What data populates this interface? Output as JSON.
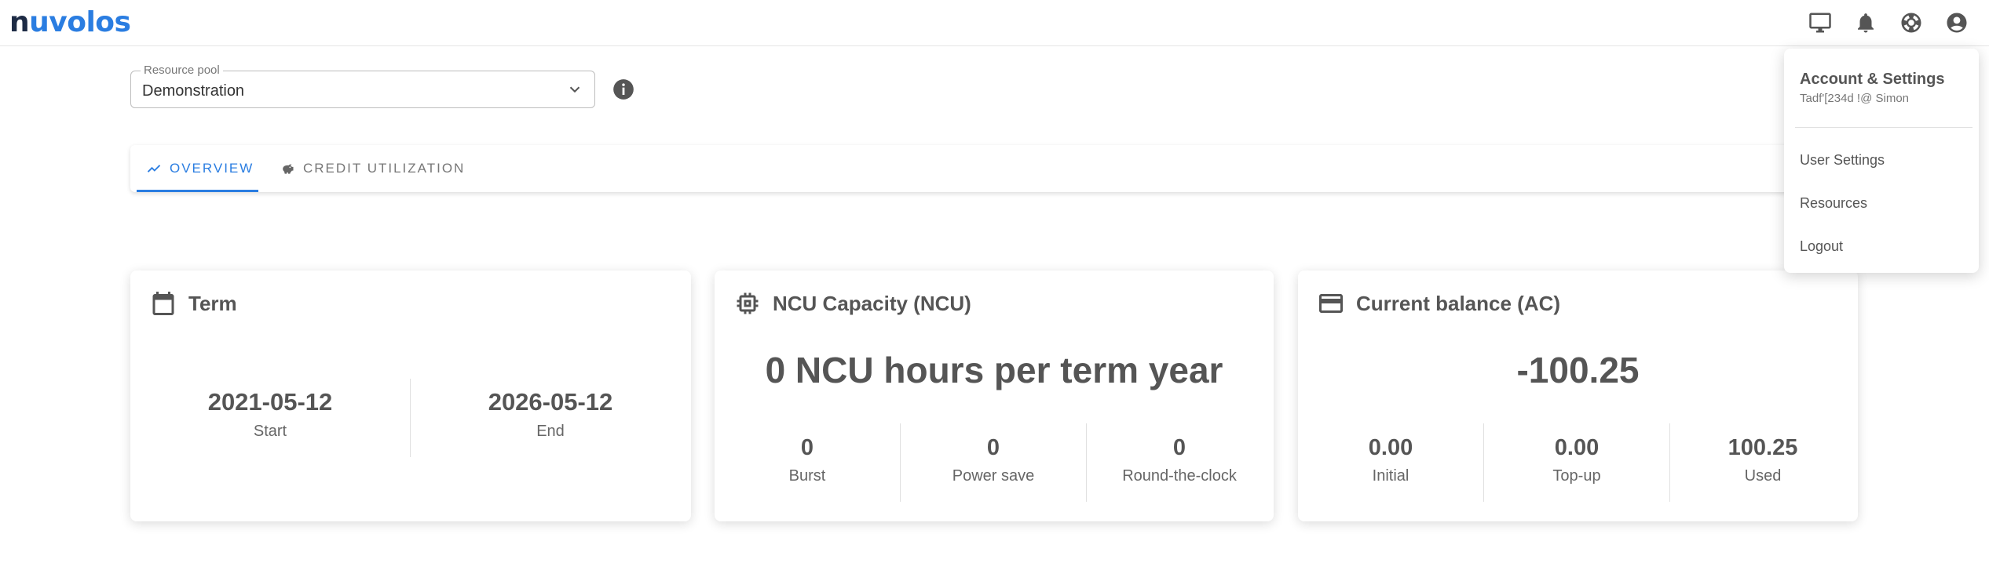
{
  "brand": {
    "logo_first": "n",
    "logo_rest": "uvolos"
  },
  "topbar": {
    "icons": [
      "desktop-icon",
      "bell-icon",
      "lifebuoy-icon",
      "account-icon"
    ]
  },
  "resource_pool": {
    "label": "Resource pool",
    "value": "Demonstration"
  },
  "tabs": [
    {
      "label": "OVERVIEW",
      "active": true
    },
    {
      "label": "CREDIT UTILIZATION",
      "active": false
    }
  ],
  "cards": {
    "term": {
      "title": "Term",
      "start_date": "2021-05-12",
      "start_label": "Start",
      "end_date": "2026-05-12",
      "end_label": "End"
    },
    "ncu": {
      "title": "NCU Capacity (NCU)",
      "headline": "0 NCU hours per term year",
      "stats": [
        {
          "value": "0",
          "label": "Burst"
        },
        {
          "value": "0",
          "label": "Power save"
        },
        {
          "value": "0",
          "label": "Round-the-clock"
        }
      ]
    },
    "balance": {
      "title": "Current balance (AC)",
      "headline": "-100.25",
      "stats": [
        {
          "value": "0.00",
          "label": "Initial"
        },
        {
          "value": "0.00",
          "label": "Top-up"
        },
        {
          "value": "100.25",
          "label": "Used"
        }
      ]
    }
  },
  "account_menu": {
    "title": "Account & Settings",
    "subtitle": "Tadf'[234d !@ Simon",
    "items": [
      "User Settings",
      "Resources",
      "Logout"
    ]
  },
  "colors": {
    "accent": "#2a7de1",
    "logo_dark": "#1d2b45",
    "text": "#555555"
  }
}
